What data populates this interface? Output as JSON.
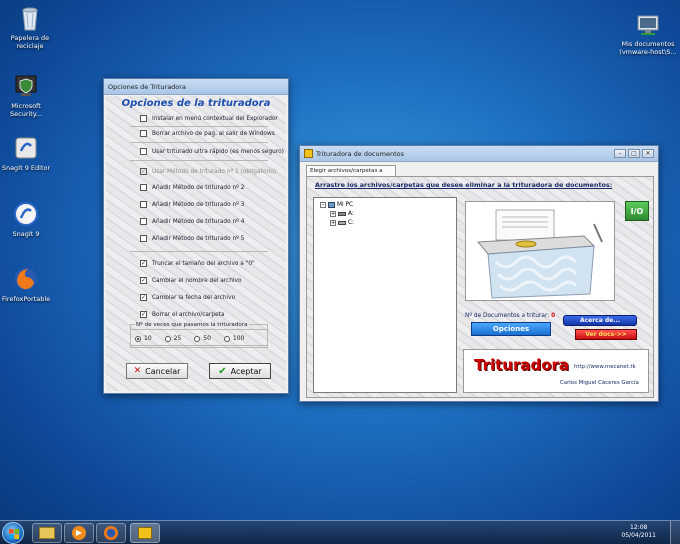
{
  "desktop": {
    "icons": [
      {
        "label": "Papelera de reciclaje"
      },
      {
        "label": "Microsoft Security..."
      },
      {
        "label": "SnagIt 9 Editor"
      },
      {
        "label": "SnagIt 9"
      },
      {
        "label": "FirefoxPortable"
      },
      {
        "label": "Mis documentos (vmware-host\\S..."
      }
    ]
  },
  "options_window": {
    "title": "Opciones de Trituradora",
    "heading": "Opciones de la trituradora",
    "checkboxes": [
      {
        "label": "Instalar en menú contextual del Explorador",
        "checked": false,
        "disabled": false
      },
      {
        "label": "Borrar archivo de pag. al salir de Windows",
        "checked": false,
        "disabled": false
      },
      {
        "label": "Usar triturado ultra rápido (es menos seguro)",
        "checked": false,
        "disabled": false
      },
      {
        "label": "Usar Método de triturado nº 1 (obligatorio)",
        "checked": true,
        "disabled": true
      },
      {
        "label": "Añadir Método de triturado nº 2",
        "checked": false,
        "disabled": false
      },
      {
        "label": "Añadir Método de triturado nº 3",
        "checked": false,
        "disabled": false
      },
      {
        "label": "Añadir Método de triturado nº 4",
        "checked": false,
        "disabled": false
      },
      {
        "label": "Añadir Método de triturado nº 5",
        "checked": false,
        "disabled": false
      },
      {
        "label": "Truncar el tamaño del archivo a \"0\"",
        "checked": true,
        "disabled": false
      },
      {
        "label": "Cambiar el nombre del archivo",
        "checked": true,
        "disabled": false
      },
      {
        "label": "Cambiar la fecha del archivo",
        "checked": true,
        "disabled": false
      },
      {
        "label": "Borrar el archivo/carpeta",
        "checked": true,
        "disabled": false
      }
    ],
    "passes_group": {
      "label": "Nº de veces que pasamos la trituradora",
      "options": [
        "10",
        "25",
        "50",
        "100"
      ],
      "selected": "10"
    },
    "cancel_label": "Cancelar",
    "accept_label": "Aceptar"
  },
  "main_window": {
    "title": "Trituradora de documentos",
    "tab_label": "Elegir archivos/carpetas a triturar",
    "instruction": "Arrastre los archivos/carpetas que desee eliminar a la trituradora de documentos:",
    "tree": {
      "root": "Mi PC",
      "children": [
        "A:",
        "C:"
      ]
    },
    "power_label": "I/O",
    "doc_count_label": "Nº de Documentos a triturar:",
    "doc_count_value": "0",
    "opciones_label": "Opciones",
    "acerca_label": "Acerca de...",
    "ver_docs_label": "Ver docs->>",
    "brand_title": "Trituradora",
    "url": "http://www.mecanet.tk",
    "author": "Carlos Miguel Cáceres García"
  },
  "taskbar": {
    "time": "12:08",
    "date": "05/04/2011"
  },
  "colors": {
    "heading_blue": "#1d4fb0",
    "brand_red": "#c80000",
    "opciones_bg": "#1f7fe0",
    "acerca_bg": "#1a46c8",
    "ver_docs_bg": "#e01818",
    "power_green": "#3aa83a"
  }
}
